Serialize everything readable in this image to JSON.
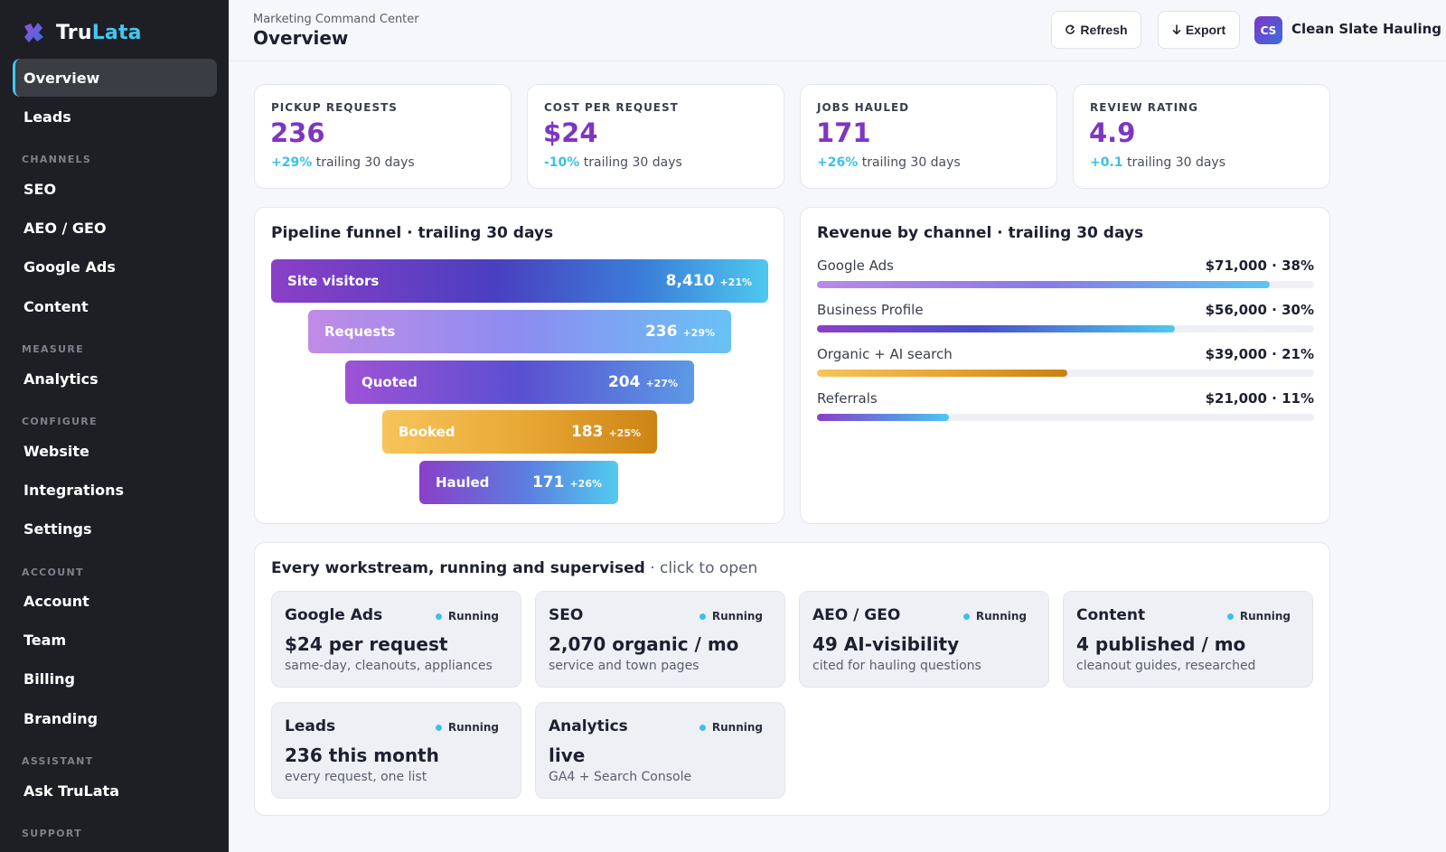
{
  "brand": {
    "name_part1": "Tru",
    "name_part2": "Lata",
    "accent": "#43c6f0"
  },
  "sidebar": {
    "items": [
      {
        "label": "Overview",
        "active": true
      },
      {
        "label": "Leads"
      }
    ],
    "sections": [
      {
        "title": "CHANNELS",
        "items": [
          "SEO",
          "AEO / GEO",
          "Google Ads",
          "Content"
        ]
      },
      {
        "title": "MEASURE",
        "items": [
          "Analytics"
        ]
      },
      {
        "title": "CONFIGURE",
        "items": [
          "Website",
          "Integrations",
          "Settings"
        ]
      },
      {
        "title": "ACCOUNT",
        "items": [
          "Account",
          "Team",
          "Billing",
          "Branding"
        ]
      },
      {
        "title": "ASSISTANT",
        "items": [
          "Ask TruLata"
        ]
      },
      {
        "title": "SUPPORT",
        "items": []
      }
    ]
  },
  "header": {
    "eyebrow": "Marketing Command Center",
    "title": "Overview",
    "refresh_label": "Refresh",
    "export_label": "Export",
    "avatar_initials": "CS",
    "account_name": "Clean Slate Hauling"
  },
  "kpis": [
    {
      "label": "PICKUP REQUESTS",
      "value": "236",
      "delta": "+29%",
      "period": "trailing 30 days"
    },
    {
      "label": "COST PER REQUEST",
      "value": "$24",
      "delta": "-10%",
      "period": "trailing 30 days"
    },
    {
      "label": "JOBS HAULED",
      "value": "171",
      "delta": "+26%",
      "period": "trailing 30 days"
    },
    {
      "label": "REVIEW RATING",
      "value": "4.9",
      "delta": "+0.1",
      "period": "trailing 30 days"
    }
  ],
  "funnel": {
    "title": "Pipeline funnel · trailing 30 days",
    "stages": [
      {
        "label": "Site visitors",
        "value": "8,410",
        "delta": "+21%"
      },
      {
        "label": "Requests",
        "value": "236",
        "delta": "+29%"
      },
      {
        "label": "Quoted",
        "value": "204",
        "delta": "+27%"
      },
      {
        "label": "Booked",
        "value": "183",
        "delta": "+25%"
      },
      {
        "label": "Hauled",
        "value": "171",
        "delta": "+26%"
      }
    ]
  },
  "revenue": {
    "title": "Revenue by channel · trailing 30 days",
    "rows": [
      {
        "name": "Google Ads",
        "amount": "$71,000",
        "percent_label": "38%",
        "share": 0.91
      },
      {
        "name": "Business Profile",
        "amount": "$56,000",
        "percent_label": "30%",
        "share": 0.72
      },
      {
        "name": "Organic + AI search",
        "amount": "$39,000",
        "percent_label": "21%",
        "share": 0.503
      },
      {
        "name": "Referrals",
        "amount": "$21,000",
        "percent_label": "11%",
        "share": 0.265
      }
    ]
  },
  "workstreams": {
    "title": "Every workstream, running and supervised",
    "hint": "click to open",
    "separator": " · ",
    "items": [
      {
        "name": "Google Ads",
        "status": "Running",
        "metric": "$24 per request",
        "sub": "same-day, cleanouts, appliances"
      },
      {
        "name": "SEO",
        "status": "Running",
        "metric": "2,070 organic / mo",
        "sub": "service and town pages"
      },
      {
        "name": "AEO / GEO",
        "status": "Running",
        "metric": "49 AI-visibility",
        "sub": "cited for hauling questions"
      },
      {
        "name": "Content",
        "status": "Running",
        "metric": "4 published / mo",
        "sub": "cleanout guides, researched"
      },
      {
        "name": "Leads",
        "status": "Running",
        "metric": "236 this month",
        "sub": "every request, one list"
      },
      {
        "name": "Analytics",
        "status": "Running",
        "metric": "live",
        "sub": "GA4 + Search Console"
      }
    ]
  },
  "colors": {
    "primary": "#7e36c2",
    "accent": "#3cc0e8",
    "sidebar_bg": "#1e1f24"
  }
}
